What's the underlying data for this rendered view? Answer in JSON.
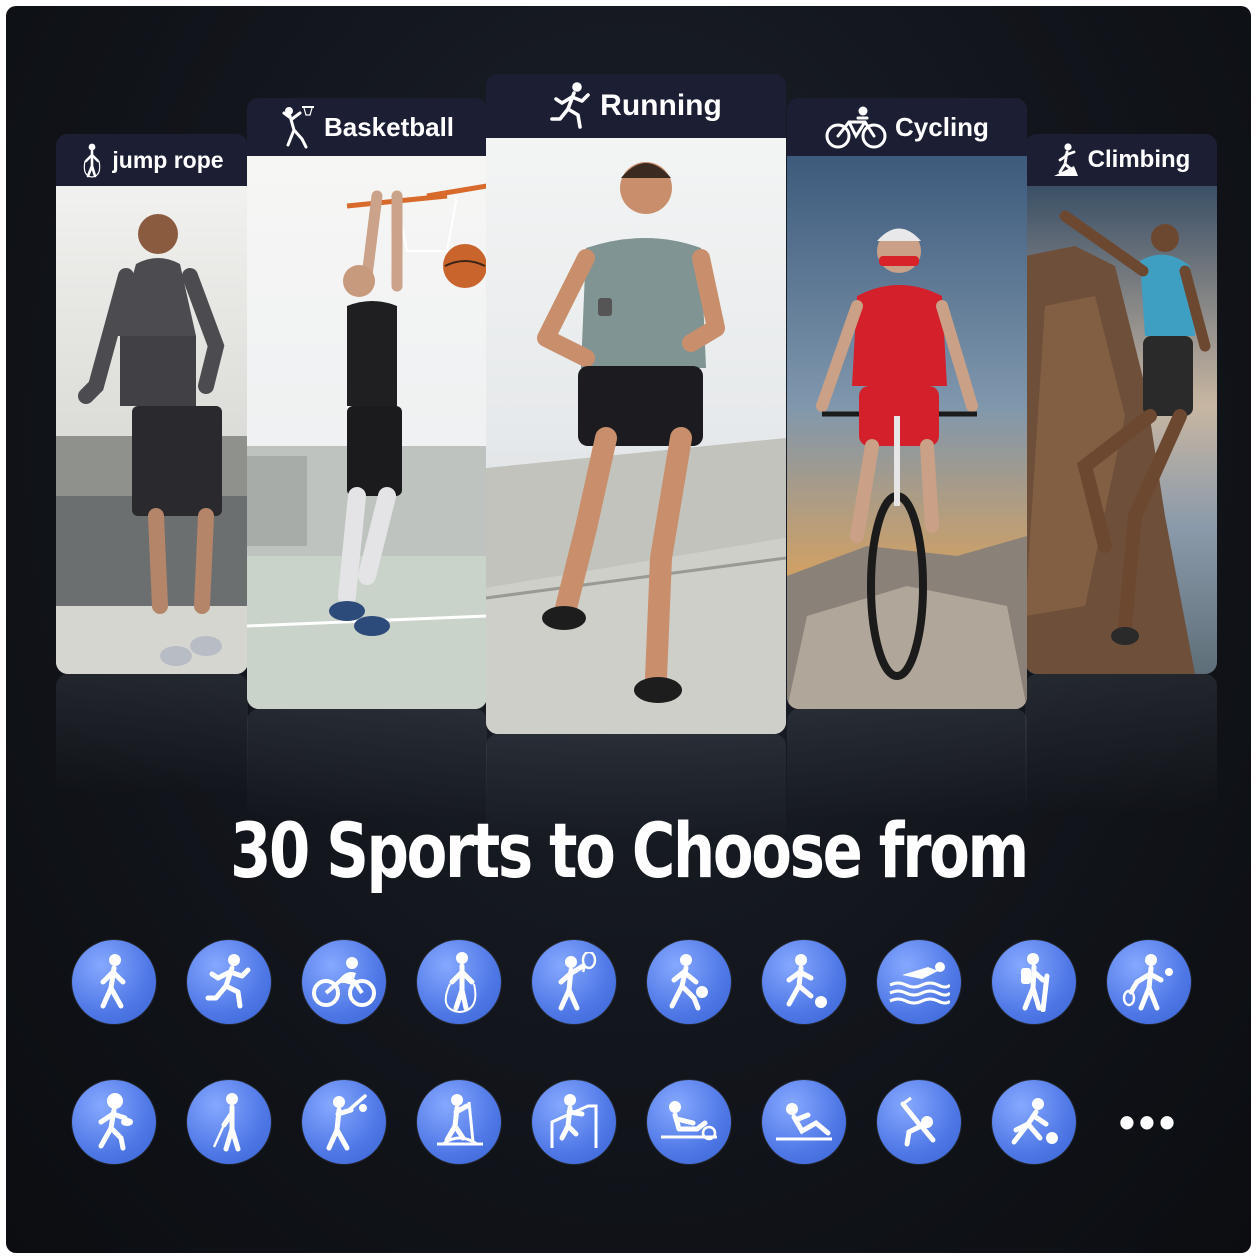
{
  "cards": [
    {
      "label": "jump rope",
      "icon": "jump-rope-icon"
    },
    {
      "label": "Basketball",
      "icon": "basketball-icon"
    },
    {
      "label": "Running",
      "icon": "running-icon"
    },
    {
      "label": "Cycling",
      "icon": "cycling-icon"
    },
    {
      "label": "Climbing",
      "icon": "climbing-icon"
    }
  ],
  "headline": "30 Sports to Choose from",
  "sport_icons_row1": [
    "walking-icon",
    "running-icon",
    "cycling-icon",
    "jump-rope-icon",
    "badminton-icon",
    "basketball-icon",
    "soccer-icon",
    "swimming-icon",
    "hiking-icon",
    "tennis-icon"
  ],
  "sport_icons_row2": [
    "football-icon",
    "golf-icon",
    "baseball-icon",
    "elliptical-icon",
    "stair-climber-icon",
    "rowing-icon",
    "sit-ups-icon",
    "yoga-icon",
    "bowling-icon"
  ],
  "more_label": "•••",
  "colors": {
    "background": "#12151b",
    "tab": "#1c1f33",
    "icon_blue": "#4f78e6",
    "text": "#ffffff"
  }
}
